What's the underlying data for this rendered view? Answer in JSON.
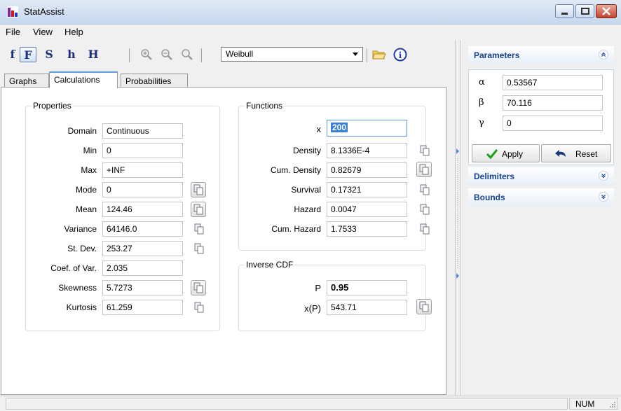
{
  "window": {
    "title": "StatAssist"
  },
  "menu": {
    "file": "File",
    "view": "View",
    "help": "Help"
  },
  "toolbar": {
    "buttons": [
      {
        "label": "f",
        "icon": "pdf-function-icon"
      },
      {
        "label": "F",
        "icon": "cdf-function-icon",
        "active": true
      },
      {
        "label": "S",
        "icon": "survival-function-icon"
      },
      {
        "label": "h",
        "icon": "hazard-function-icon"
      },
      {
        "label": "H",
        "icon": "cumulative-hazard-icon"
      }
    ],
    "distribution": "Weibull"
  },
  "tabs": [
    "Graphs",
    "Calculations",
    "Probabilities"
  ],
  "properties": {
    "title": "Properties",
    "rows": [
      {
        "label": "Domain",
        "value": "Continuous"
      },
      {
        "label": "Min",
        "value": "0"
      },
      {
        "label": "Max",
        "value": "+INF"
      },
      {
        "label": "Mode",
        "value": "0"
      },
      {
        "label": "Mean",
        "value": "124.46"
      },
      {
        "label": "Variance",
        "value": "64146.0"
      },
      {
        "label": "St. Dev.",
        "value": "253.27"
      },
      {
        "label": "Coef. of Var.",
        "value": "2.035"
      },
      {
        "label": "Skewness",
        "value": "5.7273"
      },
      {
        "label": "Kurtosis",
        "value": "61.259"
      }
    ]
  },
  "functions": {
    "title": "Functions",
    "x_label": "x",
    "x_value": "200",
    "rows": [
      {
        "label": "Density",
        "value": "8.1336E-4"
      },
      {
        "label": "Cum. Density",
        "value": "0.82679"
      },
      {
        "label": "Survival",
        "value": "0.17321"
      },
      {
        "label": "Hazard",
        "value": "0.0047"
      },
      {
        "label": "Cum. Hazard",
        "value": "1.7533"
      }
    ]
  },
  "inverse_cdf": {
    "title": "Inverse CDF",
    "p_label": "P",
    "p_value": "0.95",
    "xp_label": "x(P)",
    "xp_value": "543.71"
  },
  "parameters": {
    "title": "Parameters",
    "alpha_label": "α",
    "alpha": "0.53567",
    "beta_label": "β",
    "beta": "70.116",
    "gamma_label": "γ",
    "gamma": "0",
    "apply": "Apply",
    "reset": "Reset"
  },
  "delimiters": {
    "title": "Delimiters"
  },
  "bounds": {
    "title": "Bounds"
  },
  "status": {
    "num": "NUM"
  }
}
